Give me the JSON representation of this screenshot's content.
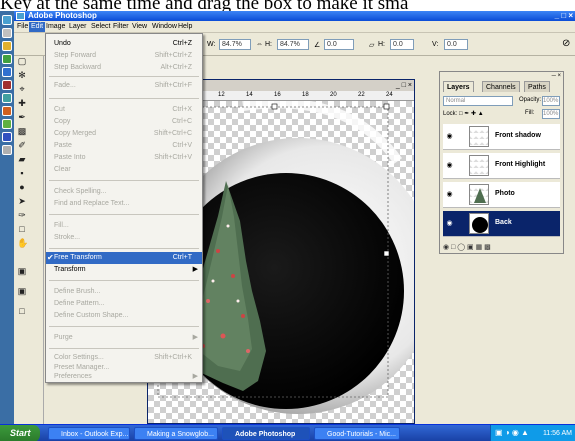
{
  "caption": "Key at the same time and drag the box to make it sma",
  "app": {
    "title": "Adobe Photoshop",
    "controls": "_ □ ×"
  },
  "menubar": [
    "File",
    "Edit",
    "Image",
    "Layer",
    "Select",
    "Filter",
    "View",
    "Window",
    "Help"
  ],
  "optionsbar": {
    "w_label": "W:",
    "w_value": "84.7%",
    "h_label": "H:",
    "h_value": "84.7%",
    "angle_value": "0.0",
    "hskew_label": "H:",
    "hskew_value": "0.0",
    "vskew_label": "V:",
    "vskew_value": "0.0"
  },
  "document": {
    "title": "ck, RGB)",
    "controls": "_ □ ×",
    "ruler_marks": [
      "10",
      "12",
      "14",
      "16",
      "18",
      "20",
      "22",
      "24"
    ]
  },
  "edit_menu": {
    "undo": {
      "label": "Undo",
      "shortcut": "Ctrl+Z"
    },
    "step_forward": {
      "label": "Step Forward",
      "shortcut": "Shift+Ctrl+Z"
    },
    "step_backward": {
      "label": "Step Backward",
      "shortcut": "Alt+Ctrl+Z"
    },
    "fade": {
      "label": "Fade...",
      "shortcut": "Shift+Ctrl+F"
    },
    "cut": {
      "label": "Cut",
      "shortcut": "Ctrl+X"
    },
    "copy": {
      "label": "Copy",
      "shortcut": "Ctrl+C"
    },
    "copy_merged": {
      "label": "Copy Merged",
      "shortcut": "Shift+Ctrl+C"
    },
    "paste": {
      "label": "Paste",
      "shortcut": "Ctrl+V"
    },
    "paste_into": {
      "label": "Paste Into",
      "shortcut": "Shift+Ctrl+V"
    },
    "clear": {
      "label": "Clear"
    },
    "check_spelling": {
      "label": "Check Spelling..."
    },
    "find_replace": {
      "label": "Find and Replace Text..."
    },
    "fill": {
      "label": "Fill..."
    },
    "stroke": {
      "label": "Stroke..."
    },
    "free_transform": {
      "label": "Free Transform",
      "shortcut": "Ctrl+T"
    },
    "transform": {
      "label": "Transform"
    },
    "define_brush": {
      "label": "Define Brush..."
    },
    "define_pattern": {
      "label": "Define Pattern..."
    },
    "define_custom_shape": {
      "label": "Define Custom Shape..."
    },
    "purge": {
      "label": "Purge"
    },
    "color_settings": {
      "label": "Color Settings...",
      "shortcut": "Shift+Ctrl+K"
    },
    "preset_manager": {
      "label": "Preset Manager..."
    },
    "preferences": {
      "label": "Preferences"
    }
  },
  "layers_panel": {
    "tabs": [
      "Layers",
      "Channels",
      "Paths"
    ],
    "blend_mode": "Normal",
    "opacity_label": "Opacity:",
    "opacity_value": "100%",
    "lock_label": "Lock:",
    "fill_label": "Fill:",
    "fill_value": "100%",
    "layers": [
      {
        "name": "Front shadow"
      },
      {
        "name": "Front Highlight"
      },
      {
        "name": "Photo"
      },
      {
        "name": "Back"
      }
    ]
  },
  "taskbar": {
    "start": "Start",
    "tasks": [
      "Inbox - Outlook Exp...",
      "Making a Snowglob...",
      "Adobe Photoshop",
      "Good-Tutorials - Mic..."
    ],
    "clock": "11:56 AM"
  }
}
